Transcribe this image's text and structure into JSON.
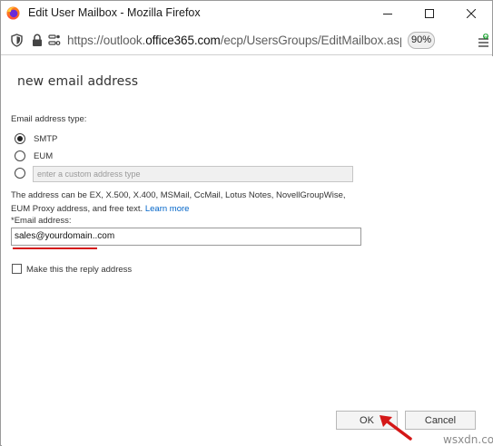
{
  "window": {
    "title": "Edit User Mailbox - Mozilla Firefox"
  },
  "urlbar": {
    "url_prefix": "https://outlook.",
    "url_domain": "office365.com",
    "url_rest": "/ecp/UsersGroups/EditMailbox.aspx?Activ",
    "zoom": "90%"
  },
  "dialog": {
    "heading": "new email address",
    "address_type_label": "Email address type:",
    "options": [
      {
        "label": "SMTP",
        "selected": true
      },
      {
        "label": "EUM",
        "selected": false
      }
    ],
    "custom_type_placeholder": "enter a custom address type",
    "help_text": "The address can be EX, X.500, X.400, MSMail, CcMail, Lotus Notes, NovellGroupWise, EUM Proxy address, and free text.",
    "learn_more": "Learn more",
    "email_label": "*Email address:",
    "email_value": "sales@yourdomain..com",
    "reply_checkbox_label": "Make this the reply address",
    "reply_checked": false,
    "ok_label": "OK",
    "cancel_label": "Cancel"
  },
  "watermark": "wsxdn.com",
  "colors": {
    "link": "#0064c8",
    "annotation_red": "#d41717"
  }
}
